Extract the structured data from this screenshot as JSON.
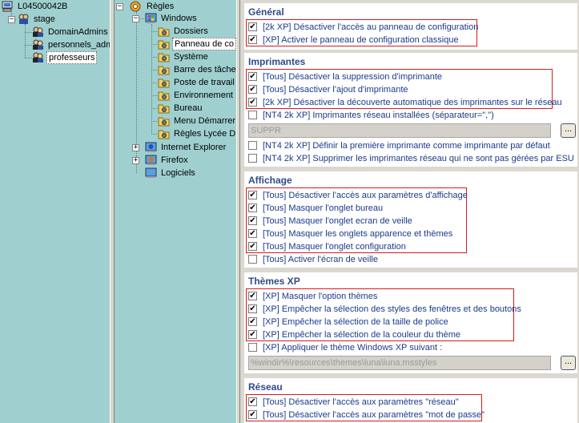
{
  "users_tree": {
    "root": "L04500042B",
    "group": "stage",
    "items": [
      "DomainAdmins",
      "personnels_adm",
      "professeurs"
    ],
    "selected": "professeurs"
  },
  "rules_tree": {
    "root": "Règles",
    "windows": "Windows",
    "windows_items": [
      "Dossiers",
      "Panneau de co",
      "Système",
      "Barre des tâche",
      "Poste de travail",
      "Environnement",
      "Bureau",
      "Menu Démarrer",
      "Règles Lycée D"
    ],
    "selected": "Panneau de co",
    "others": [
      "Internet Explorer",
      "Firefox",
      "Logiciels"
    ]
  },
  "settings": {
    "general": {
      "title": "Général",
      "items": [
        {
          "label": "[2k XP] Désactiver l'accès au panneau de configuration",
          "checked": true
        },
        {
          "label": "[XP] Activer le panneau de configuration classique",
          "checked": true
        }
      ]
    },
    "printers": {
      "title": "Imprimantes",
      "items": [
        {
          "label": "[Tous] Désactiver la suppression d'imprimante",
          "checked": true
        },
        {
          "label": "[Tous] Désactiver l'ajout d'imprimante",
          "checked": true
        },
        {
          "label": "[2k XP] Désactiver la découverte automatique des imprimantes sur le réseau",
          "checked": true
        },
        {
          "label": "[NT4 2k XP] Imprimantes réseau installées (séparateur=\",\")",
          "checked": false
        }
      ],
      "field_value": "SUPPR",
      "browse_label": "...",
      "items_after": [
        {
          "label": "[NT4 2k XP] Définir la première imprimante comme imprimante par défaut",
          "checked": false
        },
        {
          "label": "[NT4 2k XP] Supprimer les imprimantes réseau qui ne sont pas gérées par ESU",
          "checked": false
        }
      ]
    },
    "display": {
      "title": "Affichage",
      "items": [
        {
          "label": "[Tous] Désactiver l'accès aux paramètres d'affichage",
          "checked": true
        },
        {
          "label": "[Tous] Masquer l'onglet bureau",
          "checked": true
        },
        {
          "label": "[Tous] Masquer l'onglet ecran de veille",
          "checked": true
        },
        {
          "label": "[Tous] Masquer les onglets apparence et thèmes",
          "checked": true
        },
        {
          "label": "[Tous] Masquer l'onglet configuration",
          "checked": true
        },
        {
          "label": "[Tous] Activer l'écran de veille",
          "checked": false
        }
      ]
    },
    "themes": {
      "title": "Thèmes XP",
      "items": [
        {
          "label": "[XP] Masquer l'option thèmes",
          "checked": true
        },
        {
          "label": "[XP] Empêcher la sélection des styles des fenêtres et des boutons",
          "checked": true
        },
        {
          "label": "[XP] Empêcher la sélection de la taille de police",
          "checked": true
        },
        {
          "label": "[XP] Empêcher la sélection de la couleur du thème",
          "checked": true
        },
        {
          "label": "[XP] Appliquer le thème Windows XP suivant :",
          "checked": false
        }
      ],
      "field_value": "%windir%\\resources\\themes\\luna\\luna.msstyles",
      "browse_label": "..."
    },
    "network": {
      "title": "Réseau",
      "items": [
        {
          "label": "[Tous] Désactiver l'accès aux paramètres \"réseau\"",
          "checked": true
        },
        {
          "label": "[Tous] Désactiver l'accès aux paramètres \"mot de passe\"",
          "checked": true
        }
      ]
    }
  },
  "colors": {
    "pane_bg": "#9fd0cf",
    "section_title": "#2f4a8a",
    "label": "#1a3a8a",
    "highlight_box": "#d41c1c"
  }
}
